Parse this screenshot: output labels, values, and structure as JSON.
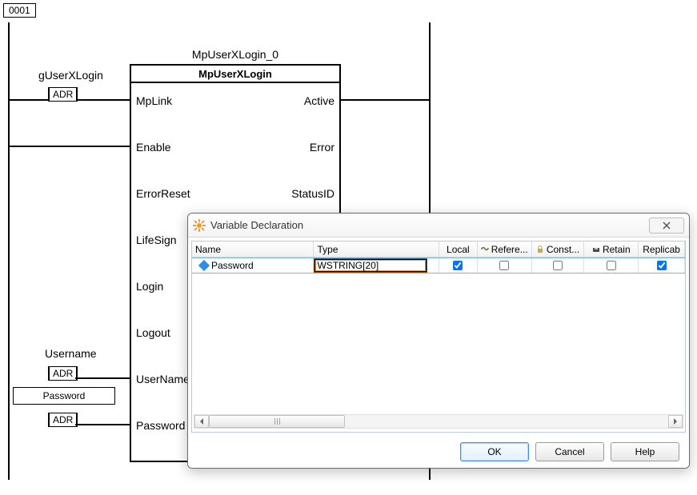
{
  "rung": {
    "label": "0001"
  },
  "fb": {
    "instance": "MpUserXLogin_0",
    "type": "MpUserXLogin",
    "inputs": {
      "mplink": "MpLink",
      "enable": "Enable",
      "errorreset": "ErrorReset",
      "lifesign": "LifeSign",
      "login": "Login",
      "logout": "Logout",
      "username": "UserName",
      "password": "Password"
    },
    "outputs": {
      "active": "Active",
      "error": "Error",
      "statusid": "StatusID"
    },
    "externals": {
      "mplink_var": "gUserXLogin",
      "mplink_adr": "ADR",
      "username_var": "Username",
      "username_adr": "ADR",
      "password_var": "Password",
      "password_adr": "ADR"
    }
  },
  "dialog": {
    "title": "Variable Declaration",
    "columns": {
      "name": "Name",
      "type": "Type",
      "local": "Local",
      "reference": "Refere...",
      "constant": "Const...",
      "retain": "Retain",
      "replicable": "Replicab"
    },
    "row": {
      "name": "Password",
      "type": "WSTRING[20]",
      "local": true,
      "reference": false,
      "constant": false,
      "retain": false,
      "replicable": true
    },
    "buttons": {
      "ok": "OK",
      "cancel": "Cancel",
      "help": "Help"
    }
  }
}
